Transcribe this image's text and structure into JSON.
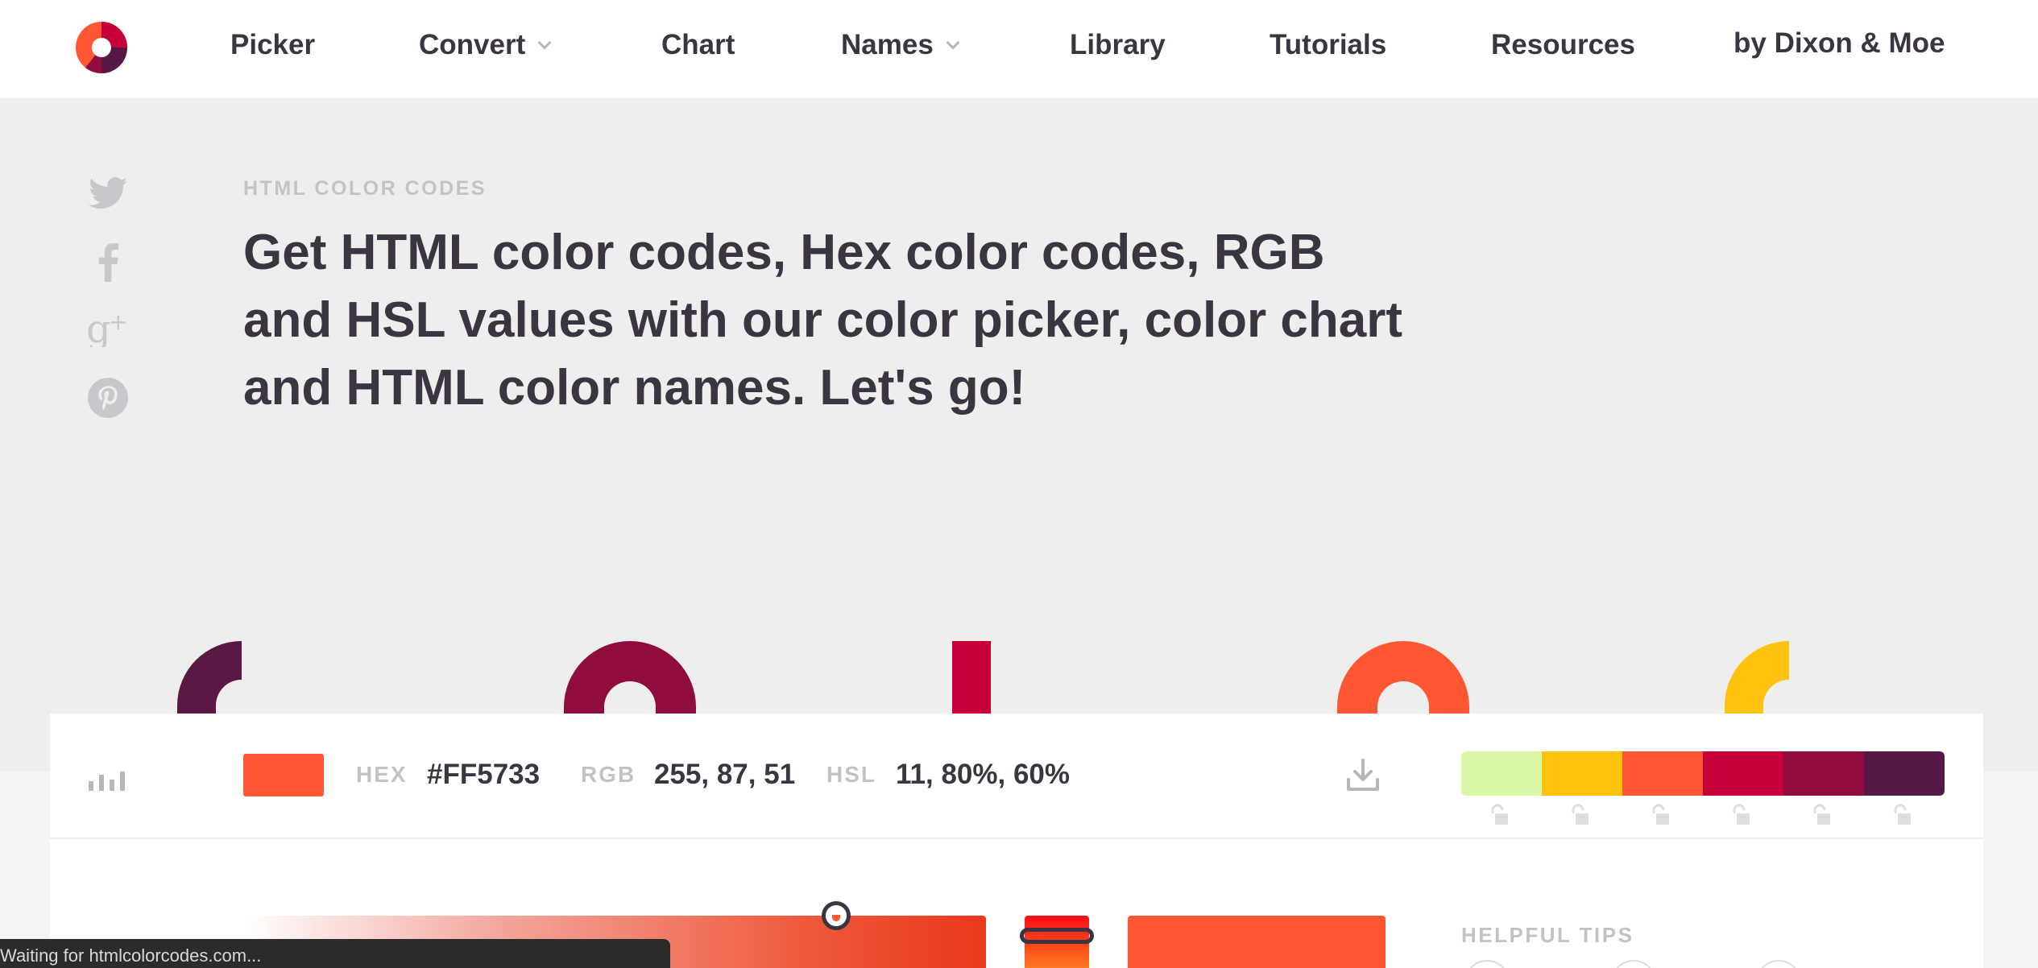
{
  "nav": {
    "logo": "htmlcolorcodes-logo",
    "items": [
      {
        "label": "Picker"
      },
      {
        "label": "Convert",
        "dropdown": true
      },
      {
        "label": "Chart"
      },
      {
        "label": "Names",
        "dropdown": true
      },
      {
        "label": "Library"
      },
      {
        "label": "Tutorials"
      },
      {
        "label": "Resources"
      }
    ],
    "byline": "by Dixon & Moe"
  },
  "social": [
    "twitter-icon",
    "facebook-icon",
    "google-plus-icon",
    "pinterest-icon"
  ],
  "hero": {
    "eyebrow": "HTML COLOR CODES",
    "headline": "Get HTML color codes, Hex color codes, RGB and HSL values with our color picker, color chart and HTML color names. Let's go!"
  },
  "decorative_shapes": {
    "colors": [
      "#5a1846",
      "#900c3e",
      "#c70039",
      "#ff5733",
      "#ffc30f"
    ]
  },
  "color_bar": {
    "swatch_color": "#FF5733",
    "hex_label": "HEX",
    "hex_value": "#FF5733",
    "rgb_label": "RGB",
    "rgb_value": "255, 87, 51",
    "hsl_label": "HSL",
    "hsl_value": "11, 80%, 60%",
    "palette": [
      "#DAF7A6",
      "#FFC30F",
      "#FF5733",
      "#C70039",
      "#900C3E",
      "#571845"
    ]
  },
  "picker": {
    "tips_title": "HELPFUL TIPS"
  },
  "status_bar": {
    "text": "Waiting for htmlcolorcodes.com..."
  },
  "colors": {
    "text": "#3b3541",
    "muted": "#c4c2c6",
    "background": "#eeeeee"
  }
}
